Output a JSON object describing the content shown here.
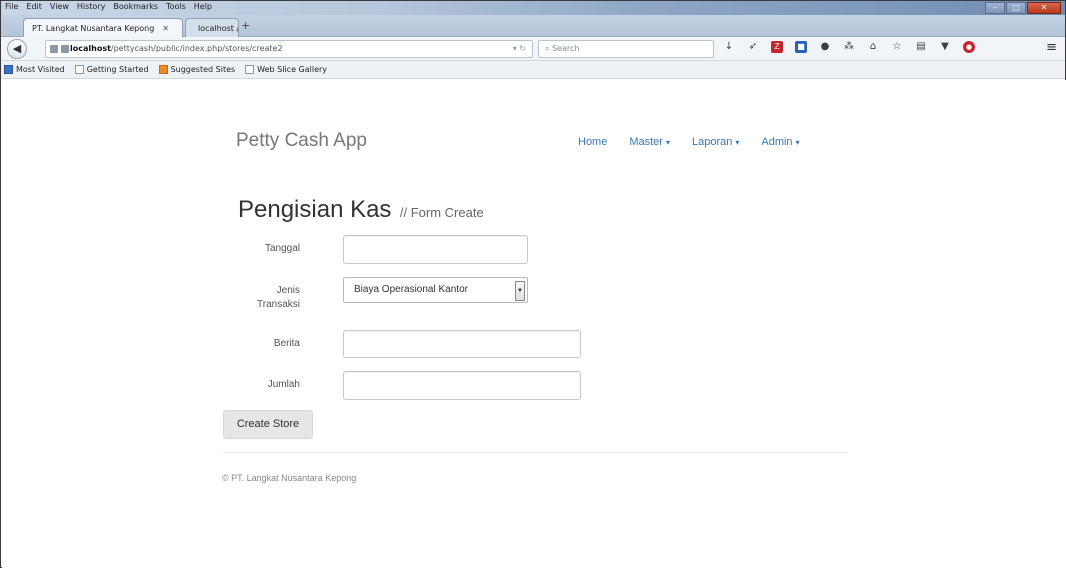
{
  "browser": {
    "menu": [
      "File",
      "Edit",
      "View",
      "History",
      "Bookmarks",
      "Tools",
      "Help"
    ],
    "tabs": [
      {
        "label": "PT. Langkat Nusantara Kepong"
      },
      {
        "label": "localhost / localhost / petty..."
      }
    ],
    "url_host": "localhost",
    "url_path": "/pettycash/public/index.php/stores/create2",
    "search_placeholder": "Search",
    "bookmarks": [
      "Most Visited",
      "Getting Started",
      "Suggested Sites",
      "Web Slice Gallery"
    ]
  },
  "app": {
    "brand": "Petty Cash App",
    "nav": [
      {
        "label": "Home",
        "dropdown": false
      },
      {
        "label": "Master",
        "dropdown": true
      },
      {
        "label": "Laporan",
        "dropdown": true
      },
      {
        "label": "Admin",
        "dropdown": true
      }
    ]
  },
  "form": {
    "title": "Pengisian Kas",
    "subtitle": "// Form Create",
    "fields": {
      "tanggal_label": "Tanggal",
      "jenis_label_line1": "Jenis",
      "jenis_label_line2": "Transaksi",
      "jenis_selected": "Biaya Operasional Kantor",
      "berita_label": "Berita",
      "jumlah_label": "Jumlah"
    },
    "submit_label": "Create Store"
  },
  "footer": {
    "text": "© PT. Langkat Nusantara Kepong"
  }
}
